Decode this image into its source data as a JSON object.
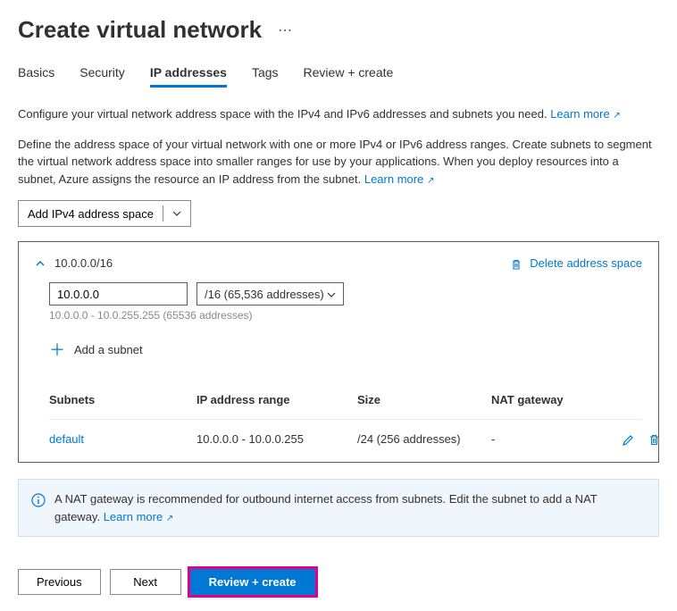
{
  "header": {
    "title": "Create virtual network"
  },
  "tabs": {
    "basics": "Basics",
    "security": "Security",
    "ip": "IP addresses",
    "tags": "Tags",
    "review": "Review + create"
  },
  "intro": {
    "line1": "Configure your virtual network address space with the IPv4 and IPv6 addresses and subnets you need.",
    "learn1": "Learn more",
    "line2": "Define the address space of your virtual network with one or more IPv4 or IPv6 address ranges. Create subnets to segment the virtual network address space into smaller ranges for use by your applications. When you deploy resources into a subnet, Azure assigns the resource an IP address from the subnet.",
    "learn2": "Learn more"
  },
  "addSpace": {
    "label": "Add IPv4 address space"
  },
  "space": {
    "cidr": "10.0.0.0/16",
    "deleteLabel": "Delete address space",
    "ipValue": "10.0.0.0",
    "maskLabel": "/16 (65,536 addresses)",
    "rangeHint": "10.0.0.0 - 10.0.255.255 (65536 addresses)",
    "addSubnet": "Add a subnet"
  },
  "subnetTable": {
    "headers": {
      "subnets": "Subnets",
      "range": "IP address range",
      "size": "Size",
      "nat": "NAT gateway"
    },
    "row": {
      "name": "default",
      "range": "10.0.0.0 - 10.0.0.255",
      "size": "/24 (256 addresses)",
      "nat": "-"
    }
  },
  "infoBox": {
    "text": "A NAT gateway is recommended for outbound internet access from subnets. Edit the subnet to add a NAT gateway.",
    "learn": "Learn more"
  },
  "footer": {
    "previous": "Previous",
    "next": "Next",
    "review": "Review + create"
  }
}
